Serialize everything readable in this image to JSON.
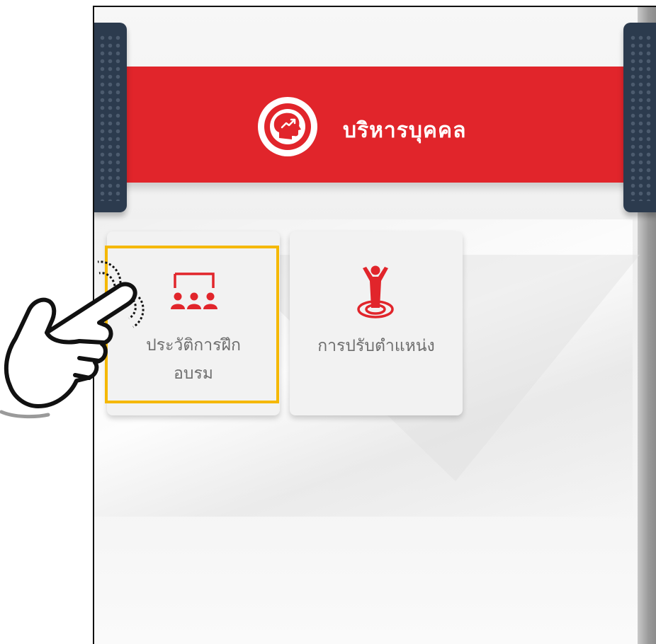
{
  "header": {
    "title": "บริหารบุคคล",
    "icon": "head-growth-icon",
    "band_color": "#e1252b"
  },
  "menu": [
    {
      "label": "ประวัติการฝึก\nอบรม",
      "line1": "ประวัติการฝึก",
      "line2": "อบรม",
      "icon": "training-board-icon"
    },
    {
      "label": "การปรับตำแหน่ง",
      "icon": "person-target-icon"
    }
  ],
  "annotation": {
    "highlight_color": "#f5b800",
    "pointer": "pointing-hand-icon"
  }
}
